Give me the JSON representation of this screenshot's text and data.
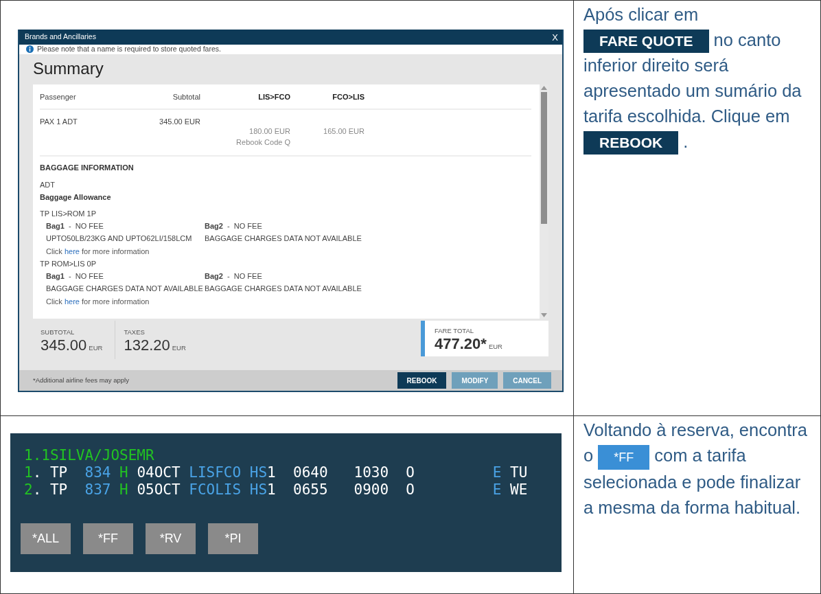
{
  "dialog": {
    "title": "Brands and Ancillaries",
    "close": "X",
    "notice": "Please note that a name is required to store quoted fares.",
    "heading": "Summary",
    "columns": [
      "Passenger",
      "Subtotal",
      "LIS>FCO",
      "FCO>LIS"
    ],
    "passengers": [
      {
        "name": "PAX 1 ADT",
        "subtotal": "345.00 EUR",
        "segments": [
          {
            "fare": "180.00 EUR",
            "note": "Rebook Code Q"
          },
          {
            "fare": "165.00 EUR"
          }
        ]
      }
    ],
    "baggage": {
      "title": "BAGGAGE INFORMATION",
      "passenger_type": "ADT",
      "allowance_title": "Baggage Allowance",
      "routes": [
        {
          "route": "TP LIS>ROM 1P",
          "bags": [
            {
              "label": "**Bag1**  -  NO FEE",
              "detail": "UPTO50LB/23KG AND UPTO62LI/158LCM"
            },
            {
              "label": "**Bag2**  -  NO FEE",
              "detail": "BAGGAGE CHARGES DATA NOT AVAILABLE"
            }
          ],
          "more_info": {
            "before": "Click",
            "link": "here",
            "after": "for more information"
          }
        },
        {
          "route": "TP ROM>LIS 0P",
          "bags": [
            {
              "label": "**Bag1**  -  NO FEE",
              "detail": "BAGGAGE CHARGES DATA NOT AVAILABLE"
            },
            {
              "label": "**Bag2**  -  NO FEE",
              "detail": "BAGGAGE CHARGES DATA NOT AVAILABLE"
            }
          ],
          "more_info": {
            "before": "Click",
            "link": "here",
            "after": "for more information"
          }
        }
      ]
    },
    "totals": [
      {
        "label": "SUBTOTAL",
        "amount": "345.00",
        "currency": "EUR",
        "kind": "plain"
      },
      {
        "label": "TAXES",
        "amount": "132.20",
        "currency": "EUR",
        "kind": "plain"
      },
      {
        "label": "FARE TOTAL",
        "amount": "477.20*",
        "currency": "EUR",
        "kind": "highlight"
      }
    ],
    "footnote": "*Additional airline fees may apply",
    "buttons": [
      {
        "label": "REBOOK",
        "kind": "primary"
      },
      {
        "label": "MODIFY",
        "kind": "secondary"
      },
      {
        "label": "CANCEL",
        "kind": "secondary"
      }
    ]
  },
  "instruction_1": [
    {
      "kind": "text",
      "text": "Após clicar em "
    },
    {
      "kind": "button",
      "text": "FARE QUOTE"
    },
    {
      "kind": "text",
      "text": " no canto inferior direito será apresentado um sumário da tarifa escolhida. Clique em "
    },
    {
      "kind": "button",
      "text": "REBOOK"
    },
    {
      "kind": "text",
      "text": " ."
    }
  ],
  "terminal": {
    "lines": [
      {
        "segments": [
          {
            "text": "1.1SILVA/JOSEMR",
            "color": "#22c322"
          }
        ]
      },
      {
        "segments": [
          {
            "text": "1",
            "color": "#22c322"
          },
          {
            "text": ". TP  ",
            "color": "#ffffff"
          },
          {
            "text": "834",
            "color": "#4aa3e6"
          },
          {
            "text": " H",
            "color": "#22c322"
          },
          {
            "text": " 04OCT ",
            "color": "#ffffff"
          },
          {
            "text": "LISFCO HS",
            "color": "#4aa3e6"
          },
          {
            "text": "1  0640   1030  O         ",
            "color": "#ffffff"
          },
          {
            "text": "E",
            "color": "#4aa3e6"
          },
          {
            "text": " TU",
            "color": "#ffffff"
          }
        ]
      },
      {
        "segments": [
          {
            "text": "2",
            "color": "#22c322"
          },
          {
            "text": ". TP  ",
            "color": "#ffffff"
          },
          {
            "text": "837",
            "color": "#4aa3e6"
          },
          {
            "text": " H",
            "color": "#22c322"
          },
          {
            "text": " 05OCT ",
            "color": "#ffffff"
          },
          {
            "text": "FCOLIS HS",
            "color": "#4aa3e6"
          },
          {
            "text": "1  0655   0900  O         ",
            "color": "#ffffff"
          },
          {
            "text": "E",
            "color": "#4aa3e6"
          },
          {
            "text": " WE",
            "color": "#ffffff"
          }
        ]
      }
    ],
    "buttons": [
      "*ALL",
      "*FF",
      "*RV",
      "*PI"
    ]
  },
  "instruction_2": [
    {
      "kind": "text",
      "text": "Voltando à reserva, encontra o "
    },
    {
      "kind": "chip",
      "text": "*FF"
    },
    {
      "kind": "text",
      "text": " com a tarifa selecionada e pode finalizar a mesma da forma habitual."
    }
  ]
}
